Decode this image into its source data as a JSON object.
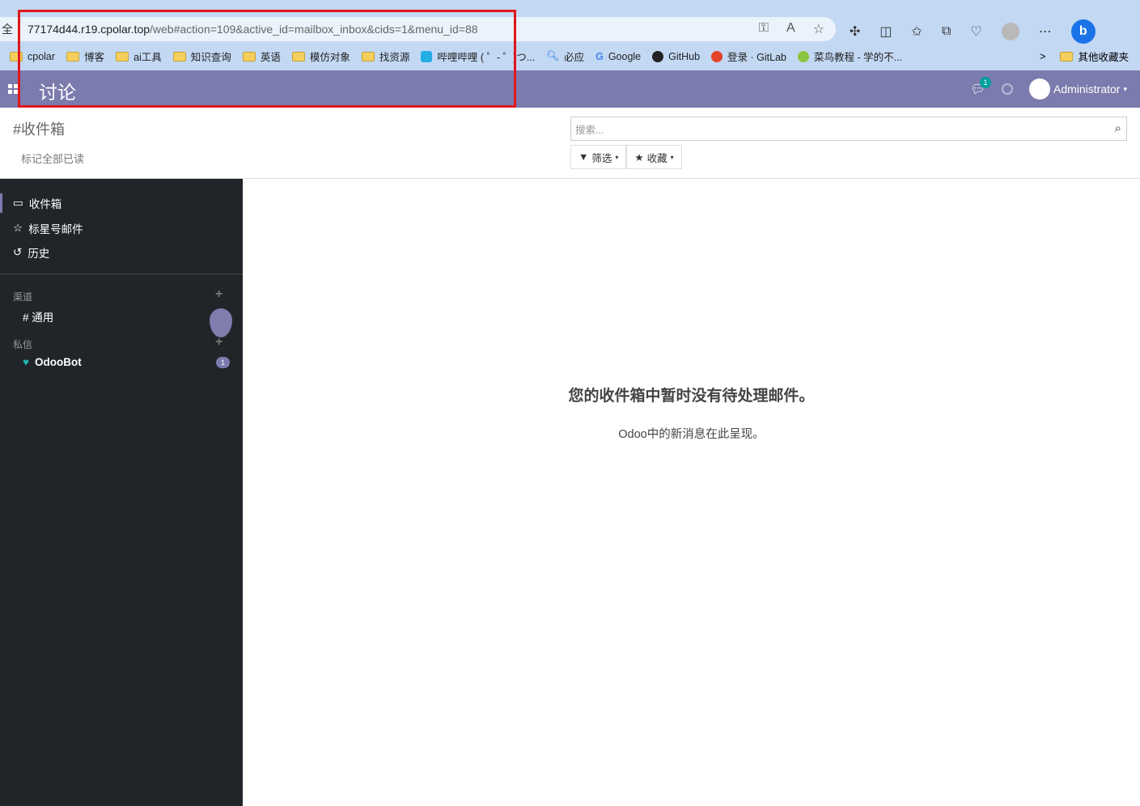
{
  "browser": {
    "addr_prefix": "全",
    "url_host": "77174d44.r19.cpolar.top",
    "url_rest": "/web#action=109&active_id=mailbox_inbox&cids=1&menu_id=88",
    "bookmarks": [
      "cpolar",
      "博客",
      "ai工具",
      "知识查询",
      "英语",
      "模仿对象",
      "找资源",
      "哔哩哔哩 ( ゜- ゜)つ...",
      "必应",
      "Google",
      "GitHub",
      "登录 · GitLab",
      "菜鸟教程 - 学的不..."
    ],
    "other_bookmarks": "其他收藏夹",
    "more": "⋯"
  },
  "navbar": {
    "title": "讨论",
    "chat_badge": "1",
    "user": "Administrator",
    "color": "#7c7bad"
  },
  "control": {
    "breadcrumb": "#收件箱",
    "mark_all_read": "标记全部已读",
    "search_placeholder": "搜索...",
    "filter": "筛选",
    "favorites": "收藏"
  },
  "sidebar": {
    "items": [
      {
        "icon": "inbox-icon",
        "label": "收件箱"
      },
      {
        "icon": "star-icon",
        "label": "标星号邮件"
      },
      {
        "icon": "history-icon",
        "label": "历史"
      }
    ],
    "channels_title": "渠道",
    "channels": [
      "# 通用"
    ],
    "dm_title": "私信",
    "dms": [
      {
        "name": "OdooBot",
        "badge": "1"
      }
    ]
  },
  "main": {
    "empty_title": "您的收件箱中暂时没有待处理邮件。",
    "empty_text": "Odoo中的新消息在此呈现。"
  }
}
